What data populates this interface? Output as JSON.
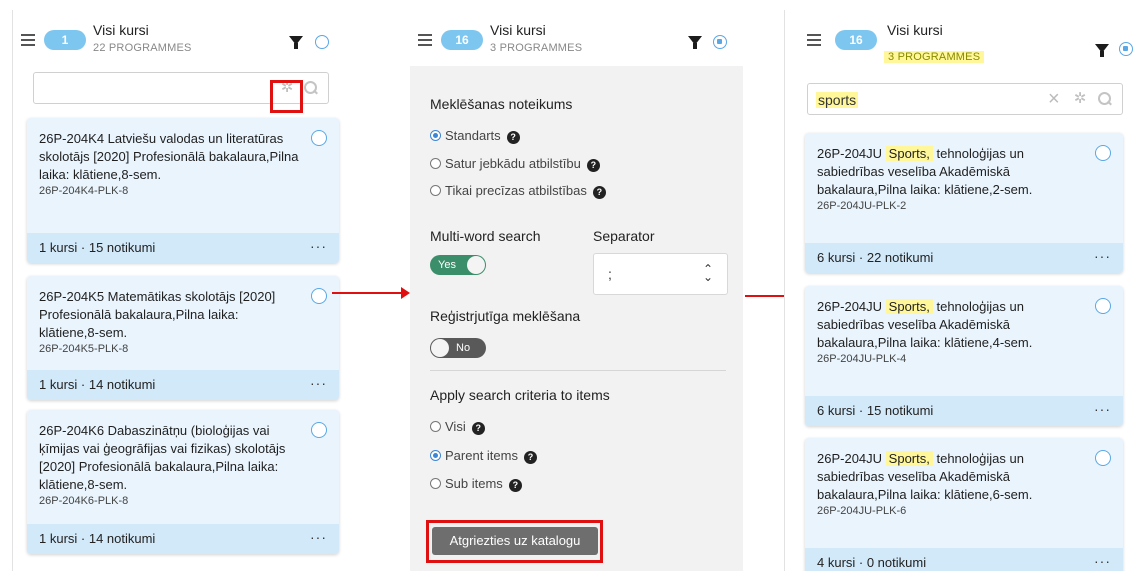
{
  "panel1": {
    "count": "1",
    "title": "Visi kursi",
    "subtitle": "22 PROGRAMMES",
    "search_value": "",
    "cards": [
      {
        "title": "26P-204K4 Latviešu valodas un literatūras skolotājs [2020] Profesionālā bakalaura,Pilna laika: klātiene,8-sem.",
        "code": "26P-204K4-PLK-8",
        "footer": "1 kursi · 15 notikumi"
      },
      {
        "title": "26P-204K5 Matemātikas skolotājs [2020] Profesionālā bakalaura,Pilna laika: klātiene,8-sem.",
        "code": "26P-204K5-PLK-8",
        "footer": "1 kursi · 14 notikumi"
      },
      {
        "title": "26P-204K6 Dabaszinātņu (bioloģijas vai ķīmijas vai ģeogrāfijas vai fizikas) skolotājs [2020] Profesionālā bakalaura,Pilna laika: klātiene,8-sem.",
        "code": "26P-204K6-PLK-8",
        "footer": "1 kursi · 14 notikumi"
      }
    ]
  },
  "panel2": {
    "count": "16",
    "title": "Visi kursi",
    "subtitle": "3 PROGRAMMES",
    "rule_label": "Meklēšanas noteikums",
    "rule_options": [
      "Standarts",
      "Satur jebkādu atbilstību",
      "Tikai precīzas atbilstības"
    ],
    "multiword_label": "Multi-word search",
    "multiword_value": "Yes",
    "separator_label": "Separator",
    "separator_value": ";",
    "case_label": "Reģistrjutīga meklēšana",
    "case_value": "No",
    "apply_label": "Apply search criteria to items",
    "apply_options": [
      "Visi",
      "Parent items",
      "Sub items"
    ],
    "back_button": "Atgriezties uz katalogu"
  },
  "panel3": {
    "count": "16",
    "title": "Visi kursi",
    "subtitle": "3 PROGRAMMES",
    "search_value": "sports",
    "card_prefix": "26P-204JU",
    "card_highlight": "Sports,",
    "cards": [
      {
        "rest": "tehnoloģijas un sabiedrības veselība Akadēmiskā bakalaura,Pilna laika: klātiene,2-sem.",
        "code": "26P-204JU-PLK-2",
        "footer": "6 kursi · 22 notikumi"
      },
      {
        "rest": "tehnoloģijas un sabiedrības veselība Akadēmiskā bakalaura,Pilna laika: klātiene,4-sem.",
        "code": "26P-204JU-PLK-4",
        "footer": "6 kursi · 15 notikumi"
      },
      {
        "rest": "tehnoloģijas un sabiedrības veselība Akadēmiskā bakalaura,Pilna laika: klātiene,6-sem.",
        "code": "26P-204JU-PLK-6",
        "footer": "4 kursi · 0 notikumi"
      }
    ]
  },
  "icons": {
    "menu": "hamburger-icon",
    "filter": "funnel-icon",
    "settings": "gear-icon",
    "search": "search-icon",
    "clear": "close-icon",
    "more": "more-dots-icon",
    "help": "question-icon"
  },
  "colors": {
    "accent": "#7cc6ef",
    "card_bg": "#e9f4fd",
    "highlight": "#fff799",
    "annotation": "#e01010",
    "toggle_on": "#3b8e6a",
    "button": "#6e6e6e"
  }
}
